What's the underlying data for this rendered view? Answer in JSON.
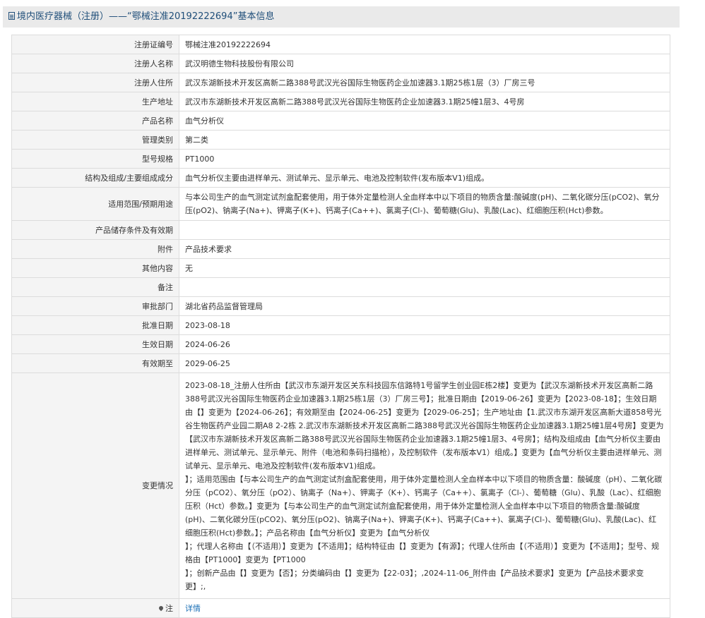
{
  "header": {
    "title": "境内医疗器械（注册）——“鄂械注准20192222694”基本信息",
    "icon": "document-icon"
  },
  "rows": [
    {
      "label": "注册证编号",
      "value": "鄂械注准20192222694"
    },
    {
      "label": "注册人名称",
      "value": "武汉明德生物科技股份有限公司"
    },
    {
      "label": "注册人住所",
      "value": "武汉东湖新技术开发区高新二路388号武汉光谷国际生物医药企业加速器3.1期25栋1层（3）厂房三号"
    },
    {
      "label": "生产地址",
      "value": "武汉市东湖新技术开发区高新二路388号武汉光谷国际生物医药企业加速器3.1期25幢1层3、4号房"
    },
    {
      "label": "产品名称",
      "value": "血气分析仪"
    },
    {
      "label": "管理类别",
      "value": "第二类"
    },
    {
      "label": "型号规格",
      "value": "PT1000"
    },
    {
      "label": "结构及组成/主要组成成分",
      "value": "血气分析仪主要由进样单元、测试单元、显示单元、电池及控制软件(发布版本V1)组成。"
    },
    {
      "label": "适用范围/预期用途",
      "value": "与本公司生产的血气测定试剂盒配套使用，用于体外定量检测人全血样本中以下项目的物质含量:酸碱度(pH)、二氧化碳分压(pCO2)、氧分压(pO2)、钠离子(Na+)、钾离子(K+)、钙离子(Ca++)、氯离子(Cl-)、葡萄糖(Glu)、乳酸(Lac)、红细胞压积(Hct)参数。"
    },
    {
      "label": "产品储存条件及有效期",
      "value": ""
    },
    {
      "label": "附件",
      "value": "产品技术要求"
    },
    {
      "label": "其他内容",
      "value": "无"
    },
    {
      "label": "备注",
      "value": ""
    },
    {
      "label": "审批部门",
      "value": "湖北省药品监督管理局"
    },
    {
      "label": "批准日期",
      "value": "2023-08-18"
    },
    {
      "label": "生效日期",
      "value": "2024-06-26"
    },
    {
      "label": "有效期至",
      "value": "2029-06-25"
    },
    {
      "label": "变更情况",
      "value": "2023-08-18_注册人住所由【武汉市东湖开发区关东科技园东信路特1号留学生创业园E栋2楼】变更为【武汉东湖新技术开发区高新二路388号武汉光谷国际生物医药企业加速器3.1期25栋1层（3）厂房三号】；批准日期由【2019-06-26】变更为【2023-08-18】；生效日期由【】变更为【2024-06-26】；有效期至由【2024-06-25】变更为【2029-06-25】；生产地址由【1.武汉市东湖开发区高新大道858号光谷生物医药产业园二期A8 2-2栋 2.武汉市东湖新技术开发区高新二路388号武汉光谷国际生物医药企业加速器3.1期25幢1层4号房】变更为【武汉市东湖新技术开发区高新二路388号武汉光谷国际生物医药企业加速器3.1期25幢1层3、4号房】；结构及组成由【血气分析仪主要由进样单元、测试单元、显示单元、附件（电池和条码扫描枪），及控制软件（发布版本V1）组成。】变更为【血气分析仪主要由进样单元、测试单元、显示单元、电池及控制软件(发布版本V1)组成。\n】；适用范围由【与本公司生产的血气测定试剂盒配套使用，用于体外定量检测人全血样本中以下项目的物质含量：酸碱度（pH）、二氧化碳分压（pCO2）、氧分压（pO2）、钠离子（Na+）、钾离子（K+）、钙离子（Ca++）、氯离子（Cl-）、葡萄糖（Glu）、乳酸（Lac）、红细胞压积（Hct）参数。】变更为【与本公司生产的血气测定试剂盒配套使用，用于体外定量检测人全血样本中以下项目的物质含量:酸碱度(pH)、二氧化碳分压(pCO2)、氧分压(pO2)、钠离子(Na+)、钾离子(K+)、钙离子(Ca++)、氯离子(Cl-)、葡萄糖(Glu)、乳酸(Lac)、红细胞压积(Hct)参数。】；产品名称由【血气分析仪】变更为【血气分析仪\n】；代理人名称由【（不适用）】变更为【不适用】；结构特征由【】变更为【有源】；代理人住所由【（不适用）】变更为【不适用】；型号、规格由【PT1000】变更为【PT1000\n】；创新产品由【】变更为【否】；分类编码由【】变更为【22-03】；,2024-11-06_附件由【产品技术要求】变更为【产品技术要求变更】;,"
    }
  ],
  "note": {
    "label": "注",
    "link": "详情",
    "icon": "map-pin-icon"
  }
}
